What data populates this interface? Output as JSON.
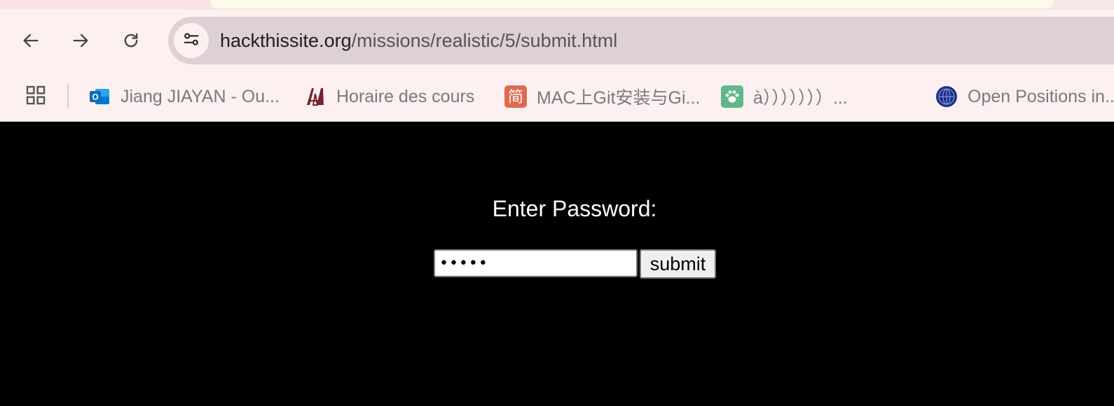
{
  "browser": {
    "url_host": "hackthissite.org",
    "url_path": "/missions/realistic/5/submit.html",
    "nav": {
      "back_icon": "arrow-left-icon",
      "forward_icon": "arrow-right-icon",
      "reload_icon": "reload-icon",
      "site_info_icon": "tune-icon"
    }
  },
  "bookmarks": {
    "apps_icon": "apps-grid-icon",
    "items": [
      {
        "label": "Jiang JIAYAN - Ou...",
        "icon": "outlook-icon",
        "color": "#0f6cbd"
      },
      {
        "label": "Horaire des cours",
        "icon": "university-logo-icon",
        "color": "#7a1f2b"
      },
      {
        "label": "MAC上Git安装与Gi...",
        "icon": "jianshu-icon",
        "glyph": "简",
        "color": "#e06a4d"
      },
      {
        "label": "à）））））））...",
        "icon": "paw-icon",
        "color": "#5fb88b"
      },
      {
        "label": "Open Positions in...",
        "icon": "globe-icon",
        "color": "#1e2f8a"
      }
    ]
  },
  "page": {
    "prompt": "Enter Password:",
    "password_value": "•••••",
    "submit_label": "submit"
  }
}
